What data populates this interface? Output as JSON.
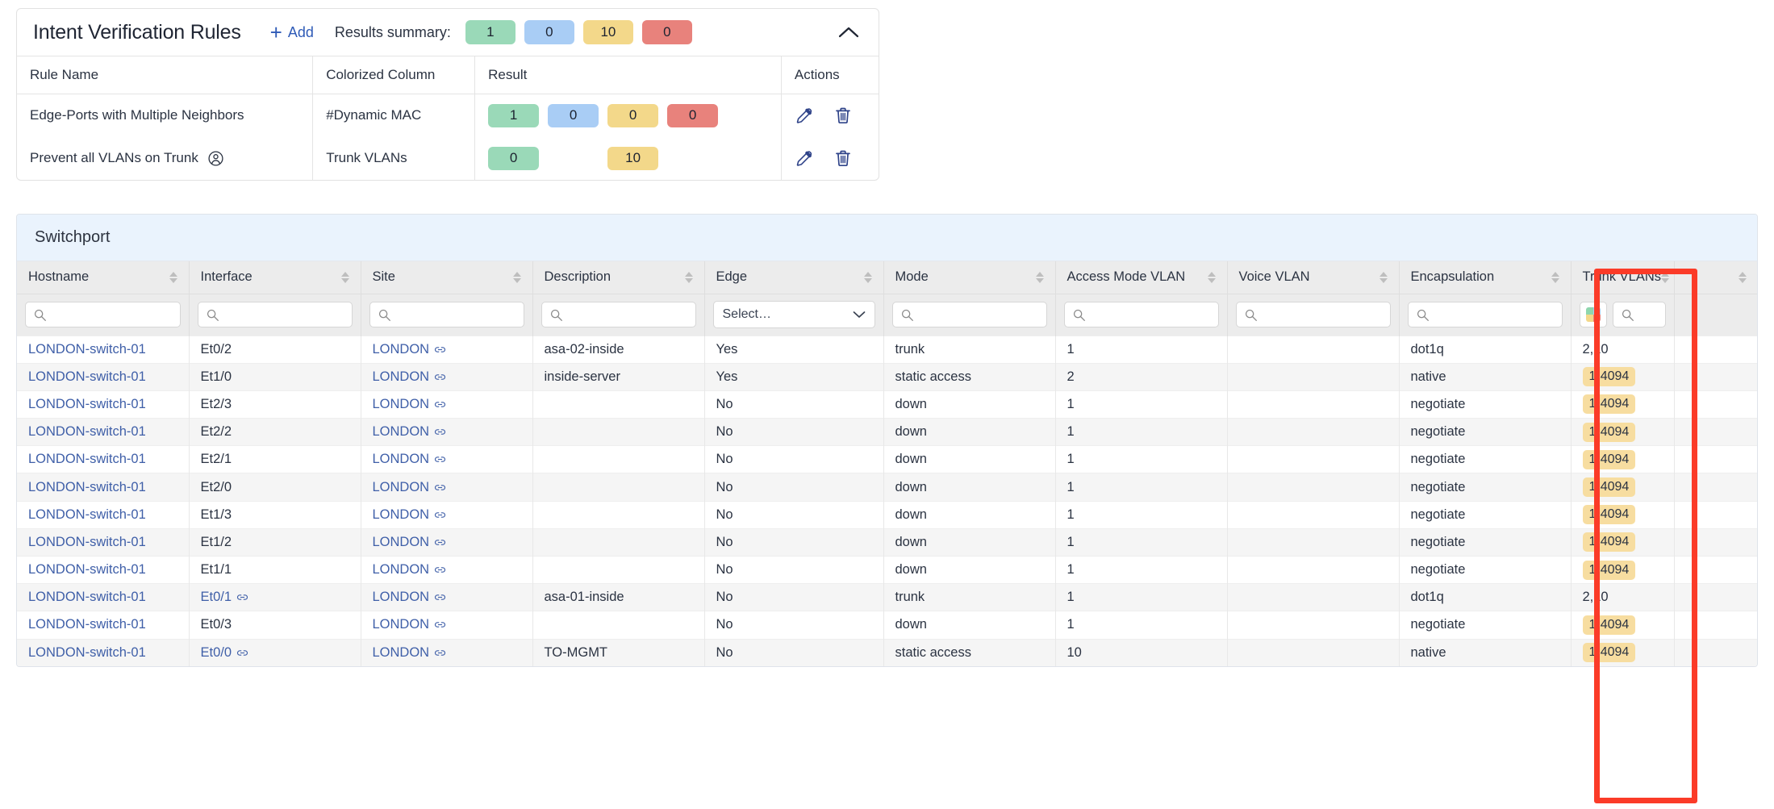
{
  "rules_panel": {
    "title": "Intent Verification Rules",
    "add_label": "Add",
    "add_icon": "plus-icon",
    "results_summary_label": "Results summary:",
    "summary_badges": [
      {
        "value": "1",
        "color": "#9ad9b8"
      },
      {
        "value": "0",
        "color": "#a9cdf5"
      },
      {
        "value": "10",
        "color": "#f3d88a"
      },
      {
        "value": "0",
        "color": "#e8827c"
      }
    ],
    "collapse_icon": "chevron-up-icon",
    "columns": [
      "Rule Name",
      "Colorized Column",
      "Result",
      "Actions"
    ],
    "rows": [
      {
        "rule_name": "Edge-Ports with Multiple Neighbors",
        "has_user_icon": false,
        "colorized_column": "#Dynamic MAC",
        "result": [
          "1",
          "0",
          "0",
          "0"
        ],
        "edit_icon": "pencil-icon",
        "delete_icon": "trash-icon"
      },
      {
        "rule_name": "Prevent all VLANs on Trunk",
        "has_user_icon": true,
        "user_icon": "user-circle-icon",
        "colorized_column": "Trunk VLANs",
        "result": [
          "0",
          "",
          "10",
          ""
        ],
        "edit_icon": "pencil-icon",
        "delete_icon": "trash-icon"
      }
    ]
  },
  "switchport": {
    "title": "Switchport",
    "columns": [
      {
        "label": "Hostname",
        "filter": "search",
        "placeholder": ""
      },
      {
        "label": "Interface",
        "filter": "search",
        "placeholder": ""
      },
      {
        "label": "Site",
        "filter": "search",
        "placeholder": ""
      },
      {
        "label": "Description",
        "filter": "search",
        "placeholder": ""
      },
      {
        "label": "Edge",
        "filter": "select",
        "placeholder": "Select…"
      },
      {
        "label": "Mode",
        "filter": "search",
        "placeholder": ""
      },
      {
        "label": "Access Mode VLAN",
        "filter": "search",
        "placeholder": ""
      },
      {
        "label": "Voice VLAN",
        "filter": "search",
        "placeholder": ""
      },
      {
        "label": "Encapsulation",
        "filter": "search",
        "placeholder": ""
      },
      {
        "label": "Trunk VLANs",
        "filter": "palette-search",
        "placeholder": ""
      },
      {
        "label": "",
        "filter": "none",
        "placeholder": ""
      }
    ],
    "rows": [
      {
        "hostname": "LONDON-switch-01",
        "interface": "Et0/2",
        "interface_link": false,
        "site": "LONDON",
        "description": "asa-02-inside",
        "edge": "Yes",
        "mode": "trunk",
        "access_mode_vlan": "1",
        "voice_vlan": "",
        "encapsulation": "dot1q",
        "trunk_vlans": "2,10",
        "trunk_highlight": false
      },
      {
        "hostname": "LONDON-switch-01",
        "interface": "Et1/0",
        "interface_link": false,
        "site": "LONDON",
        "description": "inside-server",
        "edge": "Yes",
        "mode": "static access",
        "access_mode_vlan": "2",
        "voice_vlan": "",
        "encapsulation": "native",
        "trunk_vlans": "1-4094",
        "trunk_highlight": true
      },
      {
        "hostname": "LONDON-switch-01",
        "interface": "Et2/3",
        "interface_link": false,
        "site": "LONDON",
        "description": "",
        "edge": "No",
        "mode": "down",
        "access_mode_vlan": "1",
        "voice_vlan": "",
        "encapsulation": "negotiate",
        "trunk_vlans": "1-4094",
        "trunk_highlight": true
      },
      {
        "hostname": "LONDON-switch-01",
        "interface": "Et2/2",
        "interface_link": false,
        "site": "LONDON",
        "description": "",
        "edge": "No",
        "mode": "down",
        "access_mode_vlan": "1",
        "voice_vlan": "",
        "encapsulation": "negotiate",
        "trunk_vlans": "1-4094",
        "trunk_highlight": true
      },
      {
        "hostname": "LONDON-switch-01",
        "interface": "Et2/1",
        "interface_link": false,
        "site": "LONDON",
        "description": "",
        "edge": "No",
        "mode": "down",
        "access_mode_vlan": "1",
        "voice_vlan": "",
        "encapsulation": "negotiate",
        "trunk_vlans": "1-4094",
        "trunk_highlight": true
      },
      {
        "hostname": "LONDON-switch-01",
        "interface": "Et2/0",
        "interface_link": false,
        "site": "LONDON",
        "description": "",
        "edge": "No",
        "mode": "down",
        "access_mode_vlan": "1",
        "voice_vlan": "",
        "encapsulation": "negotiate",
        "trunk_vlans": "1-4094",
        "trunk_highlight": true
      },
      {
        "hostname": "LONDON-switch-01",
        "interface": "Et1/3",
        "interface_link": false,
        "site": "LONDON",
        "description": "",
        "edge": "No",
        "mode": "down",
        "access_mode_vlan": "1",
        "voice_vlan": "",
        "encapsulation": "negotiate",
        "trunk_vlans": "1-4094",
        "trunk_highlight": true
      },
      {
        "hostname": "LONDON-switch-01",
        "interface": "Et1/2",
        "interface_link": false,
        "site": "LONDON",
        "description": "",
        "edge": "No",
        "mode": "down",
        "access_mode_vlan": "1",
        "voice_vlan": "",
        "encapsulation": "negotiate",
        "trunk_vlans": "1-4094",
        "trunk_highlight": true
      },
      {
        "hostname": "LONDON-switch-01",
        "interface": "Et1/1",
        "interface_link": false,
        "site": "LONDON",
        "description": "",
        "edge": "No",
        "mode": "down",
        "access_mode_vlan": "1",
        "voice_vlan": "",
        "encapsulation": "negotiate",
        "trunk_vlans": "1-4094",
        "trunk_highlight": true
      },
      {
        "hostname": "LONDON-switch-01",
        "interface": "Et0/1",
        "interface_link": true,
        "site": "LONDON",
        "description": "asa-01-inside",
        "edge": "No",
        "mode": "trunk",
        "access_mode_vlan": "1",
        "voice_vlan": "",
        "encapsulation": "dot1q",
        "trunk_vlans": "2,10",
        "trunk_highlight": false
      },
      {
        "hostname": "LONDON-switch-01",
        "interface": "Et0/3",
        "interface_link": false,
        "site": "LONDON",
        "description": "",
        "edge": "No",
        "mode": "down",
        "access_mode_vlan": "1",
        "voice_vlan": "",
        "encapsulation": "negotiate",
        "trunk_vlans": "1-4094",
        "trunk_highlight": true
      },
      {
        "hostname": "LONDON-switch-01",
        "interface": "Et0/0",
        "interface_link": true,
        "site": "LONDON",
        "description": "TO-MGMT",
        "edge": "No",
        "mode": "static access",
        "access_mode_vlan": "10",
        "voice_vlan": "",
        "encapsulation": "native",
        "trunk_vlans": "1-4094",
        "trunk_highlight": true
      }
    ]
  },
  "annotation": {
    "highlight_color": "#fb3b28",
    "highlighted_column": "Trunk VLANs"
  }
}
